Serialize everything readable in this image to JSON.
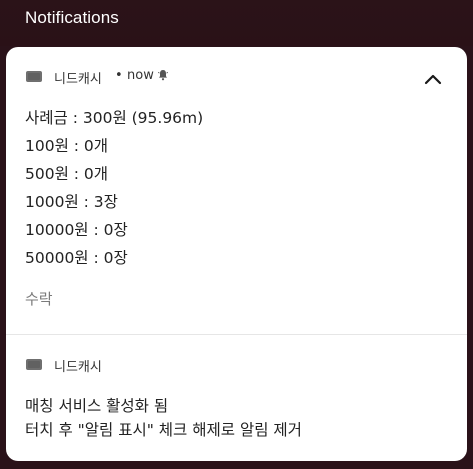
{
  "top_bar": {
    "title": "Notifications"
  },
  "notification_1": {
    "app_name": "니드캐시",
    "separator": "•",
    "time": "now",
    "lines": [
      "사례금 : 300원 (95.96m)",
      "100원 : 0개",
      "500원 : 0개",
      "1000원 : 3장",
      "10000원 : 0장",
      "50000원 : 0장"
    ],
    "action_label": "수락"
  },
  "notification_2": {
    "app_name": "니드캐시",
    "lines": [
      "매칭 서비스 활성화 됨",
      "터치 후 \"알림 표시\" 체크 해제로 알림 제거"
    ]
  },
  "colors": {
    "background": "#2a1219",
    "card": "#ffffff",
    "icon_gray": "#6f6f6f"
  },
  "icons": {
    "app_icon": "app-icon",
    "bell_icon": "bell-icon",
    "collapse_icon": "chevron-up-icon"
  }
}
